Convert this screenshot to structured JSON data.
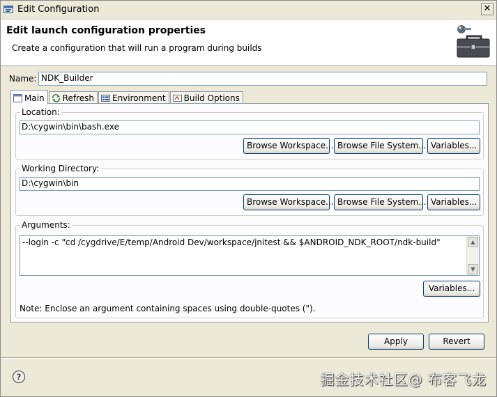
{
  "window": {
    "title": "Edit Configuration",
    "close_glyph": "✕"
  },
  "banner": {
    "title": "Edit launch configuration properties",
    "description": "Create a configuration that will run a program during builds",
    "icon": "toolbox-icon"
  },
  "name": {
    "label": "Name:",
    "value": "NDK_Builder"
  },
  "tabs": [
    {
      "label": "Main",
      "icon": "main-tab-icon",
      "active": true
    },
    {
      "label": "Refresh",
      "icon": "refresh-icon",
      "active": false
    },
    {
      "label": "Environment",
      "icon": "environment-icon",
      "active": false
    },
    {
      "label": "Build Options",
      "icon": "build-options-icon",
      "active": false
    }
  ],
  "location": {
    "label": "Location:",
    "value": "D:\\cygwin\\bin\\bash.exe",
    "browse_workspace": "Browse Workspace...",
    "browse_file_system": "Browse File System...",
    "variables": "Variables..."
  },
  "working_directory": {
    "label": "Working Directory:",
    "value": "D:\\cygwin\\bin",
    "browse_workspace": "Browse Workspace...",
    "browse_file_system": "Browse File System...",
    "variables": "Variables..."
  },
  "arguments": {
    "label": "Arguments:",
    "value": "--login -c \"cd /cygdrive/E/temp/Android Dev/workspace/jnitest && $ANDROID_NDK_ROOT/ndk-build\"",
    "variables": "Variables...",
    "note": "Note: Enclose an argument containing spaces using double-quotes (\")."
  },
  "footer": {
    "apply": "Apply",
    "revert": "Revert",
    "watermark": "掘金技术社区@ 布客飞龙"
  }
}
